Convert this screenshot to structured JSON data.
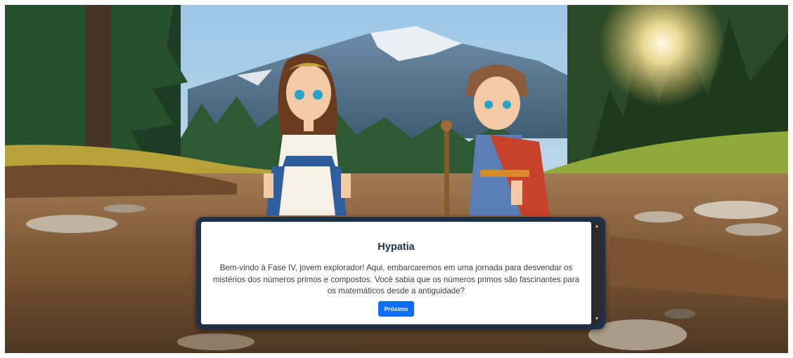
{
  "dialog": {
    "speaker": "Hypatia",
    "text": "Bem-vindo à Fase IV, jovem explorador! Aqui, embarcaremos em uma jornada para desvendar os mistérios dos números primos e compostos. Você sabia que os números primos são fascinantes para os matemáticos desde a antiguidade?",
    "next_label": "Próximo"
  },
  "icons": {
    "scroll_up": "triangle-up-icon",
    "scroll_down": "triangle-down-icon"
  },
  "colors": {
    "dialog_border": "#1e2f48",
    "speaker": "#1f2f49",
    "button": "#0d6efd"
  }
}
